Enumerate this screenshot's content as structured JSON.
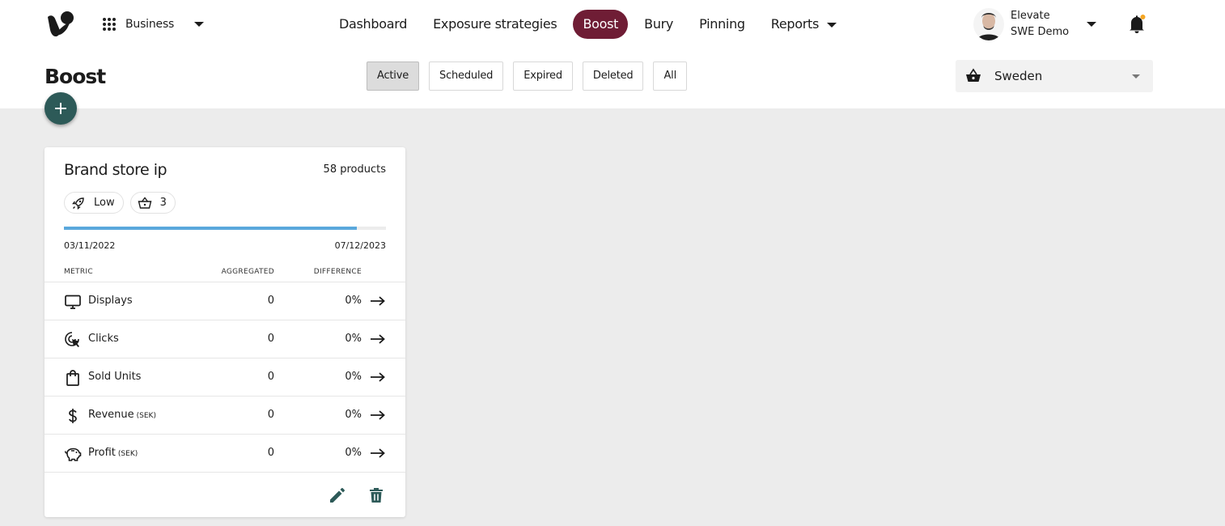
{
  "header": {
    "workspace_label": "Business",
    "nav": [
      {
        "label": "Dashboard"
      },
      {
        "label": "Exposure strategies"
      },
      {
        "label": "Boost"
      },
      {
        "label": "Bury"
      },
      {
        "label": "Pinning"
      },
      {
        "label": "Reports"
      }
    ],
    "active_nav": "Boost",
    "user": {
      "name": "Elevate",
      "org": "SWE Demo"
    },
    "notification_dot_color": "#f5a623"
  },
  "page": {
    "title": "Boost",
    "filters": [
      {
        "label": "Active",
        "active": true
      },
      {
        "label": "Scheduled",
        "active": false
      },
      {
        "label": "Expired",
        "active": false
      },
      {
        "label": "Deleted",
        "active": false
      },
      {
        "label": "All",
        "active": false
      }
    ],
    "market": "Sweden"
  },
  "card": {
    "title": "Brand store ip",
    "product_count": "58 products",
    "chips": {
      "level": "Low",
      "baskets": "3"
    },
    "progress": 0.91,
    "start_date": "03/11/2022",
    "end_date": "07/12/2023",
    "columns": {
      "metric": "METRIC",
      "aggregated": "AGGREGATED",
      "difference": "DIFFERENCE"
    },
    "metrics": [
      {
        "icon": "monitor-icon",
        "label": "Displays",
        "unit": "",
        "aggregated": "0",
        "difference": "0%"
      },
      {
        "icon": "click-icon",
        "label": "Clicks",
        "unit": "",
        "aggregated": "0",
        "difference": "0%"
      },
      {
        "icon": "shopping-bag-icon",
        "label": "Sold Units",
        "unit": "",
        "aggregated": "0",
        "difference": "0%"
      },
      {
        "icon": "dollar-icon",
        "label": "Revenue",
        "unit": "(SEK)",
        "aggregated": "0",
        "difference": "0%"
      },
      {
        "icon": "piggy-bank-icon",
        "label": "Profit",
        "unit": "(SEK)",
        "aggregated": "0",
        "difference": "0%"
      }
    ]
  },
  "colors": {
    "accent": "#6f1d35",
    "fab": "#2d5a58",
    "progress": "#5aa8dc",
    "action_icons": "#2d5a58",
    "background": "#ececec"
  }
}
